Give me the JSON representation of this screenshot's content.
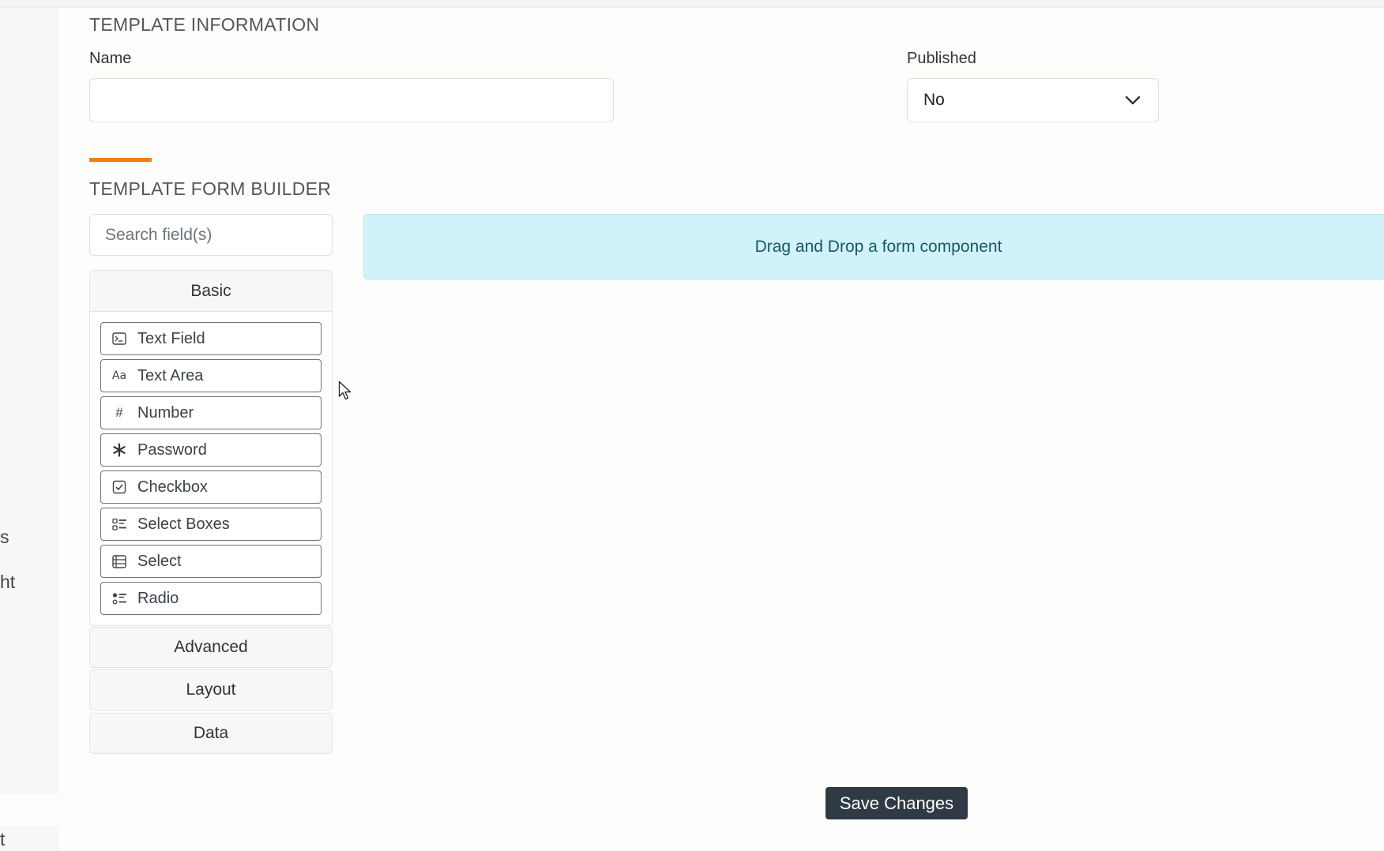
{
  "left_rail": {
    "fragments": [
      "s",
      "ht",
      "t"
    ]
  },
  "template_information": {
    "heading": "TEMPLATE INFORMATION",
    "name_label": "Name",
    "name_value": "",
    "published_label": "Published",
    "published_value": "No"
  },
  "form_builder": {
    "heading": "TEMPLATE FORM BUILDER",
    "search_placeholder": "Search field(s)",
    "groups": [
      {
        "label": "Basic",
        "expanded": true,
        "components": [
          {
            "label": "Text Field",
            "icon": "terminal-icon"
          },
          {
            "label": "Text Area",
            "icon": "font-icon"
          },
          {
            "label": "Number",
            "icon": "hash-icon"
          },
          {
            "label": "Password",
            "icon": "asterisk-icon"
          },
          {
            "label": "Checkbox",
            "icon": "check-square-icon"
          },
          {
            "label": "Select Boxes",
            "icon": "list-check-icon"
          },
          {
            "label": "Select",
            "icon": "th-list-icon"
          },
          {
            "label": "Radio",
            "icon": "list-radio-icon"
          }
        ]
      },
      {
        "label": "Advanced",
        "expanded": false
      },
      {
        "label": "Layout",
        "expanded": false
      },
      {
        "label": "Data",
        "expanded": false
      }
    ],
    "drop_zone_text": "Drag and Drop a form component"
  },
  "actions": {
    "save_label": "Save Changes"
  },
  "colors": {
    "accent": "#f07d10",
    "drop_zone_bg": "#d1f2fa",
    "drop_zone_text": "#175968",
    "save_button_bg": "#2f3a44"
  }
}
